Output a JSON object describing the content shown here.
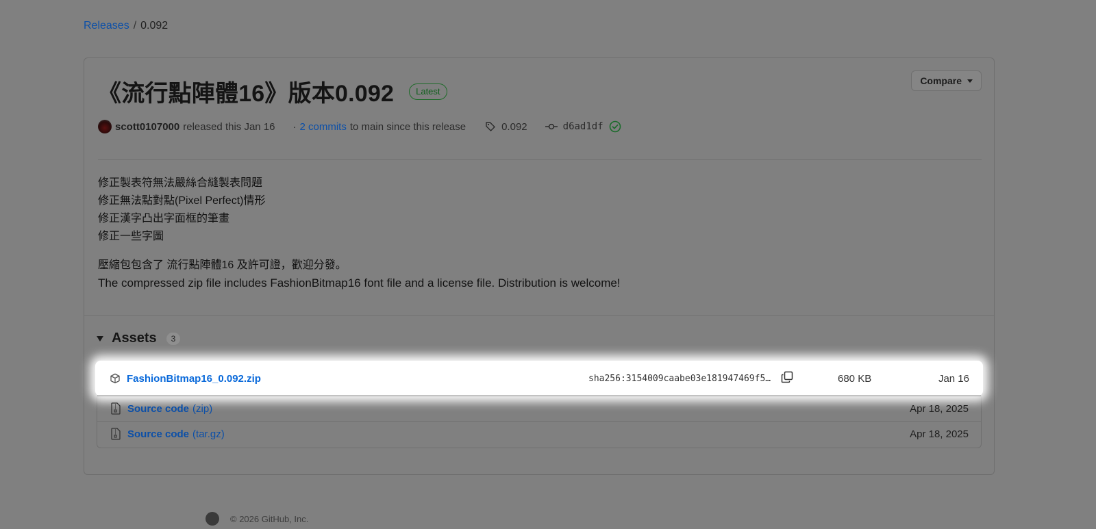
{
  "breadcrumb": {
    "releases": "Releases",
    "separator": "/",
    "current": "0.092"
  },
  "release": {
    "title": "《流行點陣體16》版本0.092",
    "badge": "Latest",
    "compare_label": "Compare",
    "author": "scott0107000",
    "released_text": "released this Jan 16",
    "dot": "·",
    "commits_link": "2 commits",
    "commits_suffix": "to main since this release",
    "tag": "0.092",
    "commit": "d6ad1df"
  },
  "notes": {
    "lines": [
      "修正製表符無法嚴絲合縫製表問題",
      "修正無法點對點(Pixel Perfect)情形",
      "修正漢字凸出字面框的筆畫",
      "修正一些字圖"
    ],
    "zh_summary": "壓縮包包含了 流行點陣體16 及許可證，歡迎分發。",
    "en_summary": "The compressed zip file includes FashionBitmap16 font file and a license file. Distribution is welcome!"
  },
  "assets": {
    "title": "Assets",
    "count": "3",
    "items": [
      {
        "name": "FashionBitmap16_0.092.zip",
        "sha": "sha256:3154009caabe03e181947469f5…",
        "size": "680 KB",
        "date": "Jan 16"
      },
      {
        "name": "Source code",
        "suffix": "(zip)",
        "date": "Apr 18, 2025"
      },
      {
        "name": "Source code",
        "suffix": "(tar.gz)",
        "date": "Apr 18, 2025"
      }
    ]
  },
  "footer": {
    "text": "© 2026 GitHub, Inc."
  },
  "colors": {
    "link": "#0969da",
    "overlay": "#808080",
    "badge_green": "#1a7f37",
    "check_green": "#1a7f37"
  }
}
